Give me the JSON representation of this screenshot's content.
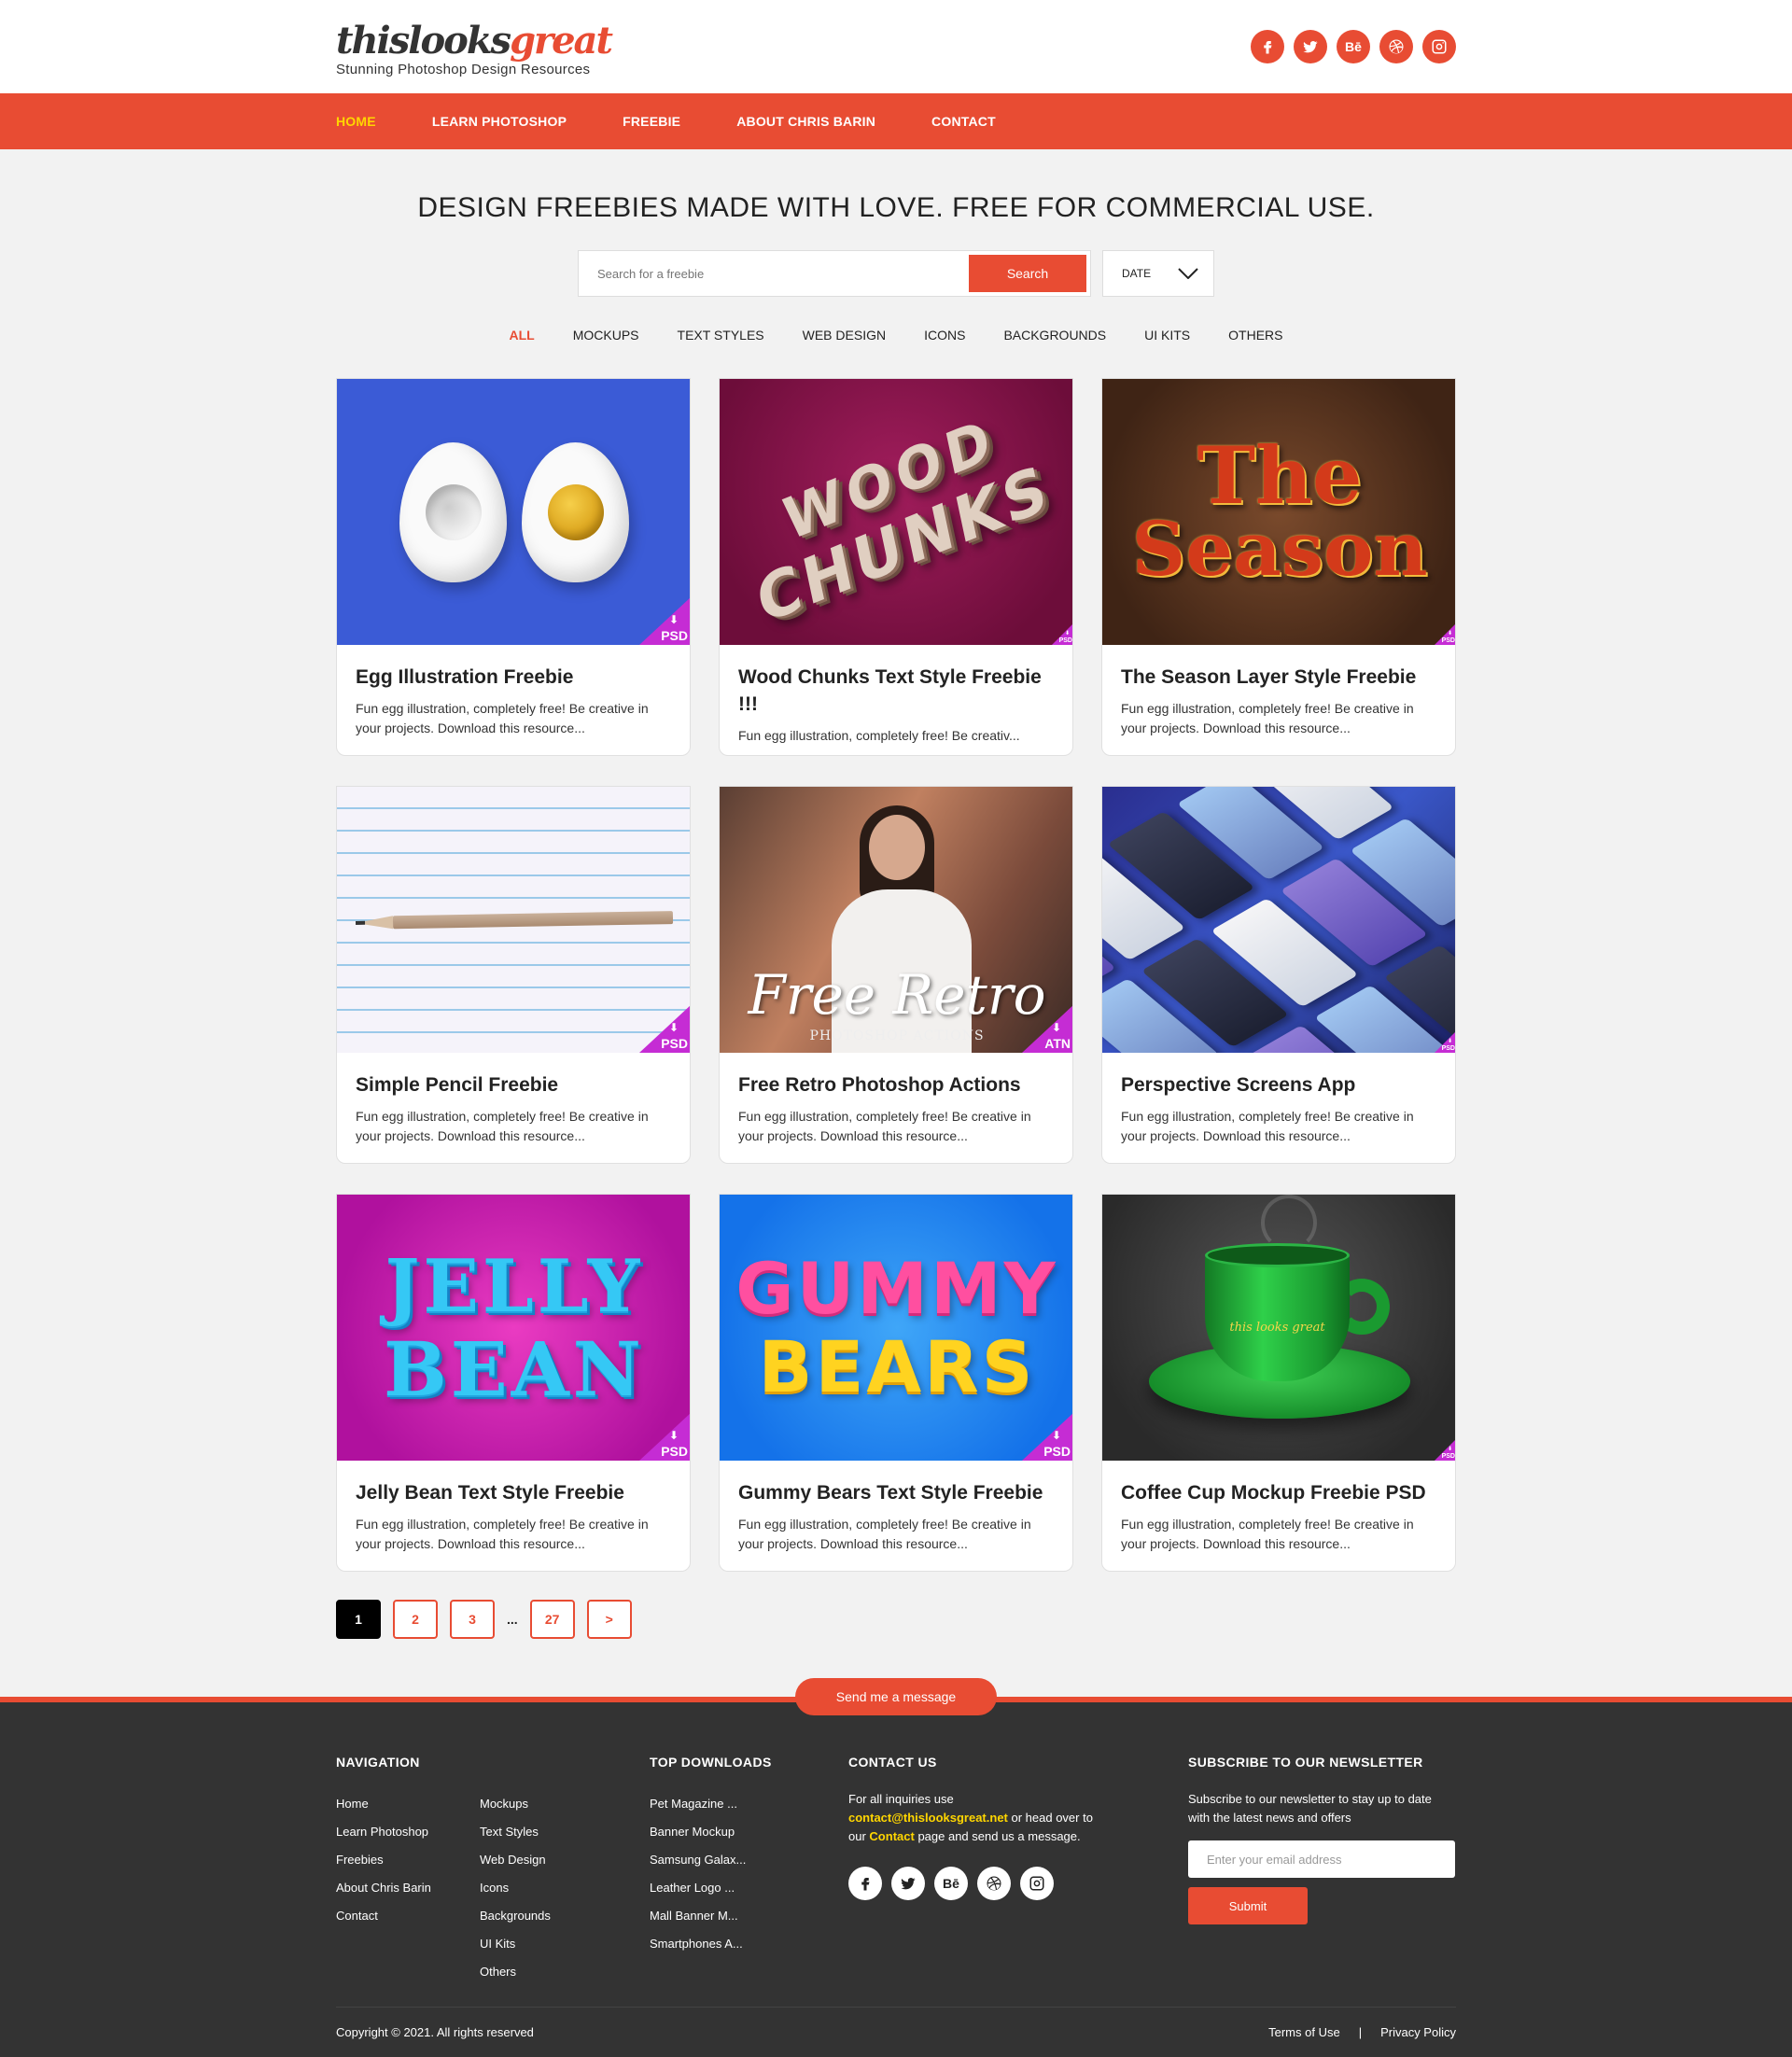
{
  "brand": {
    "logo_part1": "thislooks",
    "logo_part2": "great",
    "tagline": "Stunning Photoshop Design Resources"
  },
  "social": [
    "facebook-icon",
    "twitter-icon",
    "behance-icon",
    "dribbble-icon",
    "instagram-icon"
  ],
  "behance_label": "Bē",
  "nav": {
    "items": [
      "HOME",
      "LEARN PHOTOSHOP",
      "FREEBIE",
      "ABOUT CHRIS BARIN",
      "CONTACT"
    ],
    "active_index": 0
  },
  "hero": {
    "title": "DESIGN FREEBIES MADE WITH LOVE. FREE FOR COMMERCIAL USE."
  },
  "search": {
    "placeholder": "Search for a freebie",
    "button": "Search",
    "sort_value": "DATE"
  },
  "filters": [
    "ALL",
    "MOCKUPS",
    "TEXT STYLES",
    "WEB DESIGN",
    "ICONS",
    "BACKGROUNDS",
    "UI KITS",
    "OTHERS"
  ],
  "thumb_text": {
    "wood_line1": "WOOD",
    "wood_line2": "CHUNKS",
    "season_line1": "The",
    "season_line2": "Season",
    "retro_title": "Free Retro",
    "retro_sub": "PHOTOSHOP ACTIONS",
    "jelly_line1": "JELLY",
    "jelly_line2": "BEAN",
    "gummy_line1": "GUMMY",
    "gummy_line2": "BEARS",
    "cup_logo": "this looks great"
  },
  "badge_arrow": "⬇",
  "cards": [
    {
      "title": "Egg Illustration Freebie",
      "desc": "Fun egg illustration, completely free! Be creative in your projects. Download this resource...",
      "badge": "PSD"
    },
    {
      "title": "Wood Chunks Text Style Freebie !!!",
      "desc": "Fun egg illustration, completely free! Be creativ...",
      "badge": "PSD"
    },
    {
      "title": "The Season Layer Style Freebie",
      "desc": "Fun egg illustration, completely free! Be creative in your projects. Download this resource...",
      "badge": "PSD"
    },
    {
      "title": "Simple Pencil Freebie",
      "desc": "Fun egg illustration, completely free! Be creative in your projects. Download this resource...",
      "badge": "PSD"
    },
    {
      "title": "Free Retro Photoshop Actions",
      "desc": "Fun egg illustration, completely free! Be creative in your projects. Download this resource...",
      "badge": "ATN"
    },
    {
      "title": "Perspective Screens App",
      "desc": "Fun egg illustration, completely free! Be creative in your projects. Download this resource...",
      "badge": "PSD"
    },
    {
      "title": "Jelly Bean Text Style Freebie",
      "desc": "Fun egg illustration, completely free! Be creative in your projects. Download this resource...",
      "badge": "PSD"
    },
    {
      "title": "Gummy Bears Text Style Freebie",
      "desc": "Fun egg illustration, completely free! Be creative in your projects. Download this resource...",
      "badge": "PSD"
    },
    {
      "title": "Coffee Cup Mockup Freebie PSD",
      "desc": "Fun egg illustration, completely free! Be creative in your projects. Download this resource...",
      "badge": "PSD"
    }
  ],
  "pagination": {
    "pages": [
      "1",
      "2",
      "3",
      "...",
      "27",
      ">"
    ],
    "active": "1"
  },
  "footer": {
    "message_button": "Send me a message",
    "navigation": {
      "heading": "NAVIGATION",
      "col1": [
        "Home",
        "Learn Photoshop",
        "Freebies",
        "About Chris Barin",
        "Contact"
      ],
      "col2": [
        "Mockups",
        "Text Styles",
        "Web Design",
        "Icons",
        "Backgrounds",
        "UI Kits",
        "Others"
      ]
    },
    "top_downloads": {
      "heading": "TOP DOWNLOADS",
      "items": [
        "Pet Magazine ...",
        "Banner Mockup",
        "Samsung Galax...",
        "Leather Logo ...",
        "Mall Banner M...",
        "Smartphones A..."
      ]
    },
    "contact": {
      "heading": "CONTACT US",
      "text1": "For all inquiries use",
      "email": "contact@thislooksgreat.net",
      "text2": "or head over to our",
      "link": "Contact",
      "text3": "page and send us a message."
    },
    "newsletter": {
      "heading": "SUBSCRIBE TO OUR NEWSLETTER",
      "text": "Subscribe to our newsletter to stay up to date with the latest news and offers",
      "placeholder": "Enter your email address",
      "button": "Submit"
    },
    "copyright": "Copyright © 2021. All rights reserved",
    "terms": "Terms of Use",
    "separator": "|",
    "privacy": "Privacy Policy"
  },
  "colors": {
    "accent": "#e84c33",
    "active_nav": "#ffd600",
    "footer_bg": "#333333",
    "badge": "#c52cd4"
  }
}
